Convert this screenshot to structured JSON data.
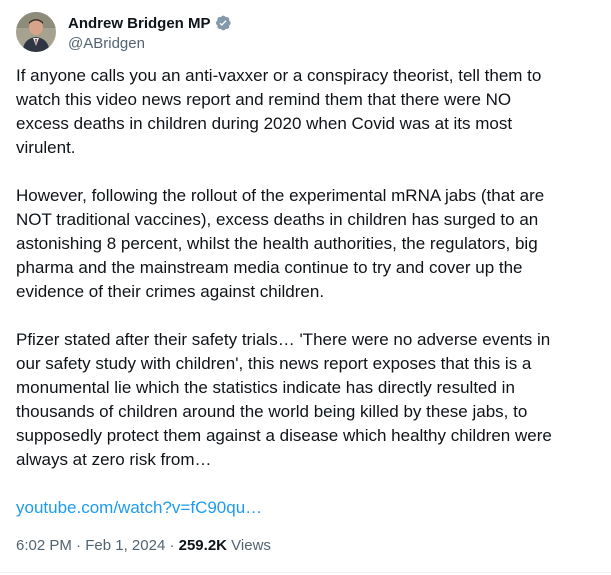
{
  "author": {
    "name": "Andrew Bridgen MP",
    "handle": "@ABridgen",
    "verified": true
  },
  "tweet": {
    "paragraphs": [
      [
        "If anyone calls you an anti-vaxxer or a conspiracy theorist, tell them to",
        "watch this video news report and remind them that there were NO",
        "excess deaths in children during 2020 when Covid was at its most",
        "virulent."
      ],
      [
        "However, following the rollout of the experimental mRNA jabs (that are",
        "NOT traditional vaccines), excess deaths in children has surged to an",
        "astonishing 8 percent, whilst the health authorities, the regulators, big",
        "pharma and the mainstream media continue to try and cover up the",
        "evidence of their crimes against children."
      ],
      [
        "Pfizer stated after their safety trials… 'There were no adverse events in",
        "our safety study with children', this news report exposes that this is a",
        "monumental lie which the statistics indicate has directly resulted in",
        "thousands of children around the world being killed by these jabs, to",
        "supposedly protect them against a disease which healthy children were",
        "always at zero risk from…"
      ]
    ],
    "link": "youtube.com/watch?v=fC90qu…"
  },
  "meta": {
    "time": "6:02 PM",
    "separator": "·",
    "date": "Feb 1, 2024",
    "views_count": "259.2K",
    "views_label": "Views"
  },
  "colors": {
    "link": "#1d9bf0",
    "verified_badge": "#829aab",
    "secondary_text": "#536471"
  }
}
